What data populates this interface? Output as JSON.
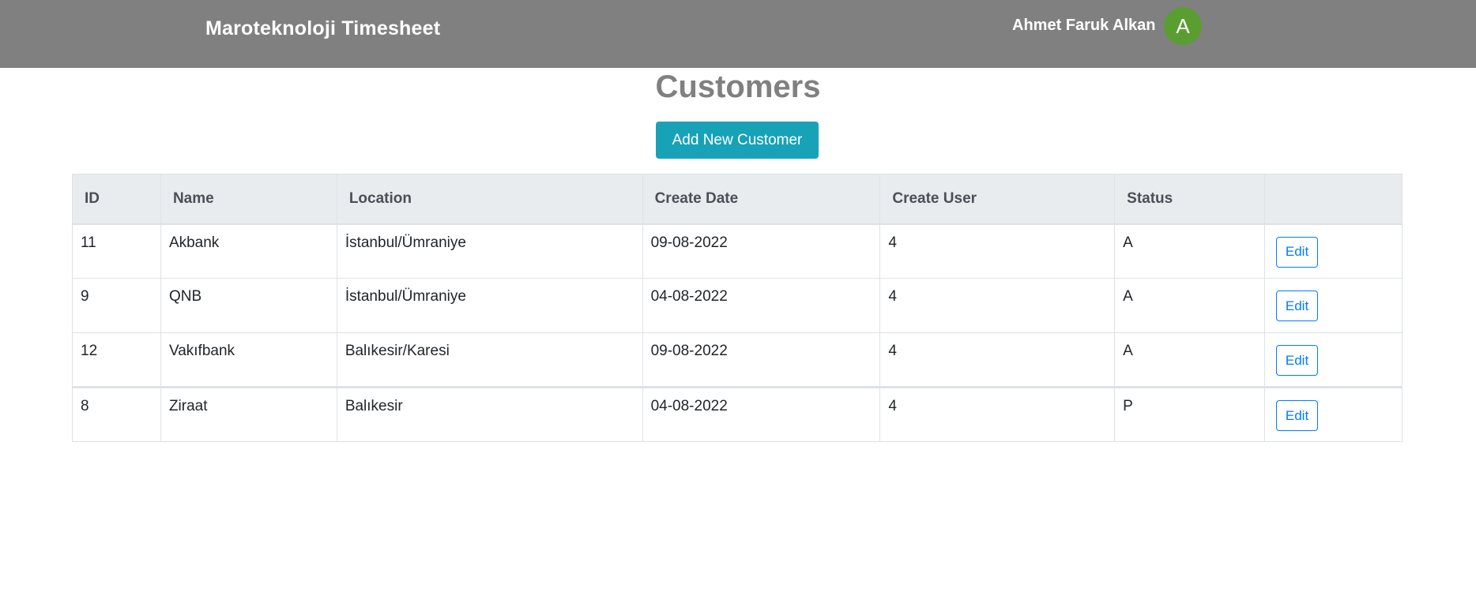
{
  "header": {
    "brand": "Maroteknoloji Timesheet",
    "user_name": "Ahmet Faruk Alkan",
    "avatar_letter": "A"
  },
  "main": {
    "title": "Customers",
    "add_button_label": "Add New Customer"
  },
  "table": {
    "columns": [
      "ID",
      "Name",
      "Location",
      "Create Date",
      "Create User",
      "Status",
      ""
    ],
    "rows": [
      {
        "id": "11",
        "name": "Akbank",
        "location": "İstanbul/Ümraniye",
        "create_date": "09-08-2022",
        "create_user": "4",
        "status": "A",
        "action": "Edit"
      },
      {
        "id": "9",
        "name": "QNB",
        "location": "İstanbul/Ümraniye",
        "create_date": "04-08-2022",
        "create_user": "4",
        "status": "A",
        "action": "Edit"
      },
      {
        "id": "12",
        "name": "Vakıfbank",
        "location": "Balıkesir/Karesi",
        "create_date": "09-08-2022",
        "create_user": "4",
        "status": "A",
        "action": "Edit"
      },
      {
        "id": "8",
        "name": "Ziraat",
        "location": "Balıkesir",
        "create_date": "04-08-2022",
        "create_user": "4",
        "status": "P",
        "action": "Edit"
      }
    ]
  },
  "colors": {
    "navbar": "#808080",
    "avatar": "#5a9e32",
    "primary_button": "#17a2b8",
    "edit_outline": "#007bff"
  }
}
